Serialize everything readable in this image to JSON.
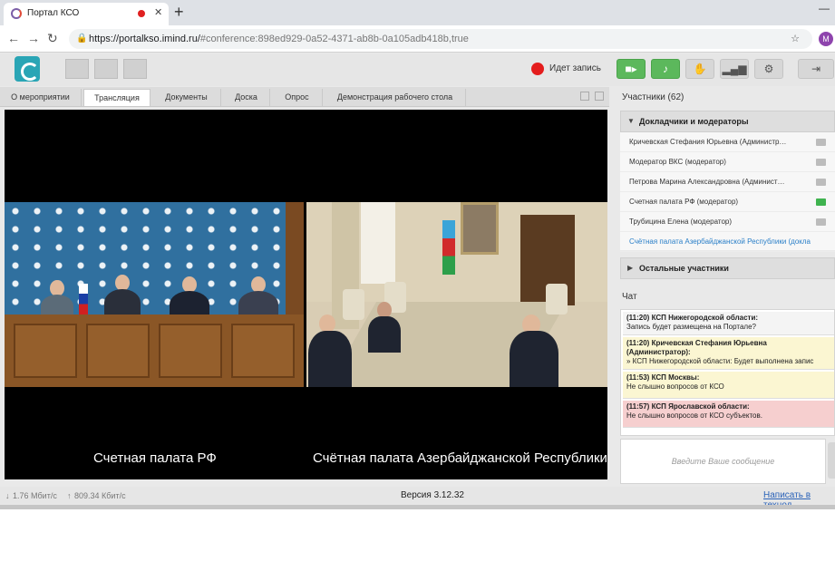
{
  "browser": {
    "tab_title": "Портал КСО",
    "url_host": "https://portalkso.imind.ru/",
    "url_path": "#conference:898ed929-0a52-4371-ab8b-0a105adb418b,true",
    "profile_initial": "M"
  },
  "toolbar": {
    "recording_label": "Идет запись"
  },
  "tabs": [
    {
      "label": "О мероприятии",
      "active": false
    },
    {
      "label": "Трансляция",
      "active": true
    },
    {
      "label": "Документы",
      "active": false
    },
    {
      "label": "Доска",
      "active": false
    },
    {
      "label": "Опрос",
      "active": false
    },
    {
      "label": "Демонстрация рабочего стола",
      "active": false
    }
  ],
  "video": {
    "left_caption": "Счетная палата РФ",
    "right_caption": "Счётная палата Азербайджанской Республики"
  },
  "participants": {
    "header": "Участники (62)",
    "group_speakers": "Докладчики и модераторы",
    "group_others": "Остальные участники",
    "list": [
      {
        "name": "Кричевская Стефания Юрьевна (Администр…",
        "camera_on": false,
        "link": false
      },
      {
        "name": "Модератор ВКС (модератор)",
        "camera_on": false,
        "link": false
      },
      {
        "name": "Петрова Марина Александровна (Админист…",
        "camera_on": false,
        "link": false
      },
      {
        "name": "Счетная палата РФ (модератор)",
        "camera_on": true,
        "link": false
      },
      {
        "name": "Трубицина Елена (модератор)",
        "camera_on": false,
        "link": false
      },
      {
        "name": "Счётная палата Азербайджанской Республики (докла",
        "camera_on": false,
        "link": true
      }
    ]
  },
  "chat": {
    "title": "Чат",
    "messages": [
      {
        "head": "(11:20) КСП Нижегородской области:",
        "text": "Запись будет размещена на Портале?",
        "style": "w"
      },
      {
        "head": "(11:20) Кричевская Стефания Юрьевна (Администратор):",
        "text": "» КСП Нижегородской области: Будет выполнена запис",
        "style": "y"
      },
      {
        "head": "(11:53) КСП Москвы:",
        "text": "Не слышно вопросов от КСО",
        "style": "y"
      },
      {
        "head": "(11:57) КСП Ярославской области:",
        "text": "Не слышно вопросов от КСО субъектов.",
        "style": "p"
      }
    ],
    "input_placeholder": "Введите Ваше сообщение"
  },
  "status": {
    "in_speed": "1.76 Мбит/с",
    "out_speed": "809.34 Кбит/с",
    "version": "Версия 3.12.32",
    "write_support": "Написать в технод"
  },
  "icons": [
    "favicon-icon",
    "close-tab-icon",
    "new-tab-icon",
    "back-icon",
    "forward-icon",
    "reload-icon",
    "lock-icon",
    "star-icon",
    "camera-icon",
    "microphone-icon",
    "hand-icon",
    "signal-icon",
    "gear-icon",
    "exit-icon"
  ],
  "colors": {
    "accent_green": "#5cb85c",
    "record_red": "#e41d1d",
    "logo_teal": "#2aa5b5",
    "link_blue": "#2a7fc8"
  }
}
